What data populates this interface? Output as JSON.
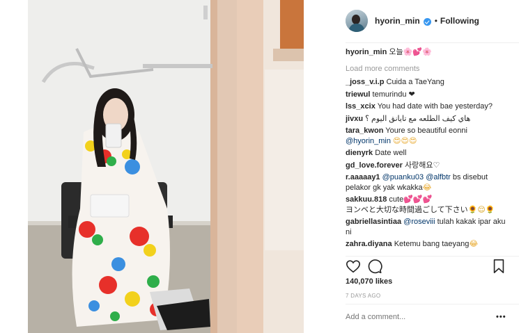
{
  "post": {
    "author": "hyorin_min",
    "follow_status": "Following",
    "separator": "•",
    "colors": {
      "accent": "#3897f0",
      "mention": "#003569",
      "muted": "#999999",
      "text": "#262626"
    }
  },
  "caption": {
    "username": "hyorin_min",
    "text": "오늘",
    "emojis": [
      "🌸",
      "💕",
      "🌸"
    ]
  },
  "load_more_label": "Load more comments",
  "comments": [
    {
      "username": "_joss_v.i.p",
      "text": "Cuida a TaeYang"
    },
    {
      "username": "triewul",
      "text": "temurindu ❤"
    },
    {
      "username": "lss_xcix",
      "text": "You had date with bae yesterday?"
    },
    {
      "username": "jivxu",
      "text": "هاي كيف الطلعه مع تايانق اليوم ؟"
    },
    {
      "username": "tara_kwon",
      "text": "Youre so beautiful eonni",
      "mention": "@hyorin_min",
      "emojis": "😍😍😍"
    },
    {
      "username": "dienyrk",
      "text": "Date well"
    },
    {
      "username": "gd_love.forever",
      "text": "사랑해요♡"
    },
    {
      "username": "r.aaaaay1",
      "mention": "@puanku03",
      "mention2": "@alfbtr",
      "text": "bs disebut pelakor gk yak wkakka",
      "emojis": "😂"
    },
    {
      "username": "sakkuu.818",
      "text": "cute",
      "emojis": "💕💕💕",
      "text2": "ヨンベと大切な時間過ごして下さい",
      "emojis2": "🌻😌🌻"
    },
    {
      "username": "gabriellasintiaa",
      "mention": "@roseviii",
      "text": "tulah kakak ipar aku ni"
    },
    {
      "username": "zahra.diyana",
      "text": "Ketemu bang taeyang",
      "emojis": "😂"
    }
  ],
  "actions": {
    "like_icon": "heart-outline-icon",
    "comment_icon": "speech-bubble-icon",
    "save_icon": "bookmark-icon"
  },
  "likes_text": "140,070 likes",
  "time_ago": "7 DAYS AGO",
  "add_comment_placeholder": "Add a comment...",
  "more_options_label": "•••"
}
